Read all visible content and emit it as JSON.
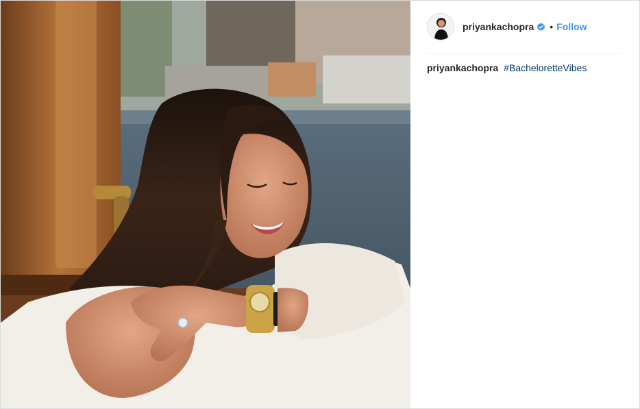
{
  "post": {
    "image_alt": "Woman with long dark hair smiling on a wooden boat along a canal, wearing a white feathered sweater, gold watch and diamond ring",
    "author": {
      "username": "priyankachopra",
      "verified": true,
      "separator": "•",
      "follow_label": "Follow"
    },
    "caption": {
      "username": "priyankachopra",
      "hashtag": "#BacheloretteVibes"
    }
  },
  "colors": {
    "follow": "#3897f0",
    "hashtag": "#003569",
    "verified": "#3897f0",
    "border": "#dbdbdb"
  },
  "icons": {
    "verified": "verified-badge-icon"
  }
}
